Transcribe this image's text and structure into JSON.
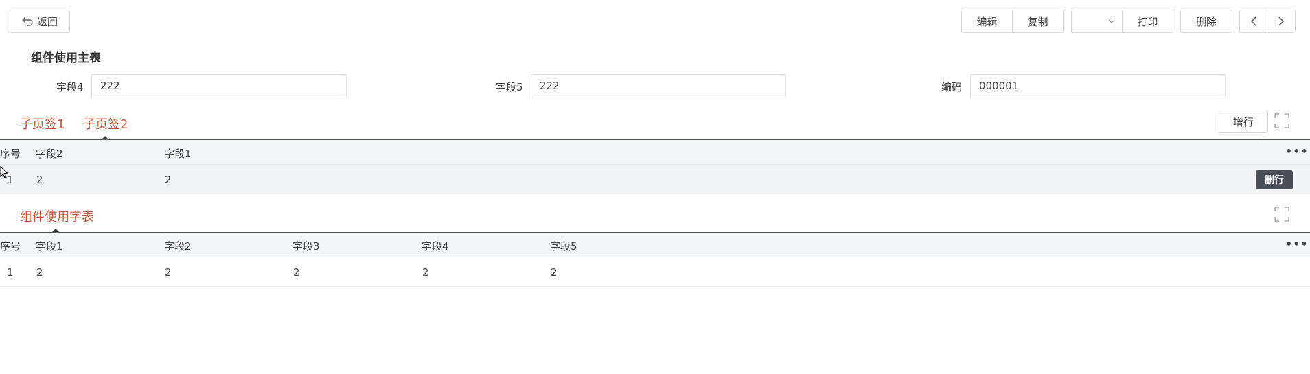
{
  "toolbar": {
    "back_label": "返回",
    "edit_label": "编辑",
    "copy_label": "复制",
    "select_value": "",
    "print_label": "打印",
    "delete_label": "删除"
  },
  "form": {
    "title": "组件使用主表",
    "fields": [
      {
        "label": "字段4",
        "value": "222"
      },
      {
        "label": "字段5",
        "value": "222"
      },
      {
        "label": "编码",
        "value": "000001"
      }
    ]
  },
  "subtabs": {
    "tabs": [
      "子页签1",
      "子页签2"
    ],
    "active": 1,
    "add_row_label": "增行",
    "table": {
      "columns": [
        "序号",
        "字段2",
        "字段1"
      ],
      "rows": [
        [
          "1",
          "2",
          "2"
        ]
      ],
      "row_action": "删行"
    }
  },
  "child": {
    "tab": "组件使用字表",
    "table": {
      "columns": [
        "序号",
        "字段1",
        "字段2",
        "字段3",
        "字段4",
        "字段5"
      ],
      "rows": [
        [
          "1",
          "2",
          "2",
          "2",
          "2",
          "2"
        ]
      ]
    }
  },
  "more_label": "•••"
}
